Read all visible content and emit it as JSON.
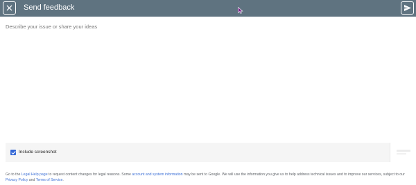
{
  "header": {
    "title": "Send feedback",
    "background": "#5f7380"
  },
  "feedback": {
    "placeholder": "Describe your issue or share your ideas",
    "value": ""
  },
  "screenshot": {
    "checked": true,
    "label": "Include screenshot",
    "accent": "#3367d6"
  },
  "legal": {
    "t1": "Go to the ",
    "link_legal_help": "Legal Help page",
    "t2": " to request content changes for legal reasons. Some ",
    "link_account_info": "account and system information",
    "t3": " may be sent to Google. We will use the information you give us to help address technical issues and to improve our services, subject to our ",
    "link_privacy": "Privacy Policy",
    "t4": " and ",
    "link_terms": "Terms of Service",
    "t5": ".",
    "link_color": "#3b6fd6"
  },
  "icons": {
    "close": "close-icon",
    "send": "send-icon",
    "check": "check-icon",
    "cursor": "mouse-cursor-icon"
  }
}
